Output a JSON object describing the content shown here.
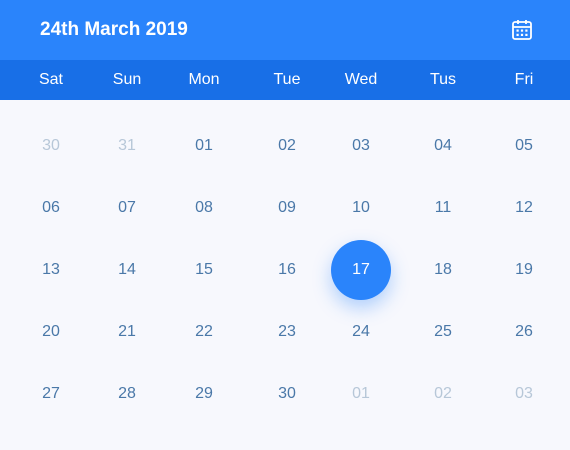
{
  "header": {
    "title": "24th March 2019",
    "calendar_icon": "calendar-icon"
  },
  "colors": {
    "header": "#2a84fb",
    "weekday_bar": "#186fe7",
    "selected": "#2a84fb",
    "day_text": "#4a78a8",
    "muted_text": "#b7c7d8"
  },
  "weekdays": [
    "Sat",
    "Sun",
    "Mon",
    "Tue",
    "Wed",
    "Tus",
    "Fri"
  ],
  "weeks": [
    [
      {
        "label": "30",
        "muted": true
      },
      {
        "label": "31",
        "muted": true
      },
      {
        "label": "01"
      },
      {
        "label": "02"
      },
      {
        "label": "03"
      },
      {
        "label": "04"
      },
      {
        "label": "05"
      }
    ],
    [
      {
        "label": "06"
      },
      {
        "label": "07"
      },
      {
        "label": "08"
      },
      {
        "label": "09"
      },
      {
        "label": "10"
      },
      {
        "label": "11"
      },
      {
        "label": "12"
      }
    ],
    [
      {
        "label": "13"
      },
      {
        "label": "14"
      },
      {
        "label": "15"
      },
      {
        "label": "16"
      },
      {
        "label": "17",
        "selected": true
      },
      {
        "label": "18"
      },
      {
        "label": "19"
      }
    ],
    [
      {
        "label": "20"
      },
      {
        "label": "21"
      },
      {
        "label": "22"
      },
      {
        "label": "23"
      },
      {
        "label": "24"
      },
      {
        "label": "25"
      },
      {
        "label": "26"
      }
    ],
    [
      {
        "label": "27"
      },
      {
        "label": "28"
      },
      {
        "label": "29"
      },
      {
        "label": "30"
      },
      {
        "label": "01",
        "muted": true
      },
      {
        "label": "02",
        "muted": true
      },
      {
        "label": "03",
        "muted": true
      }
    ]
  ]
}
